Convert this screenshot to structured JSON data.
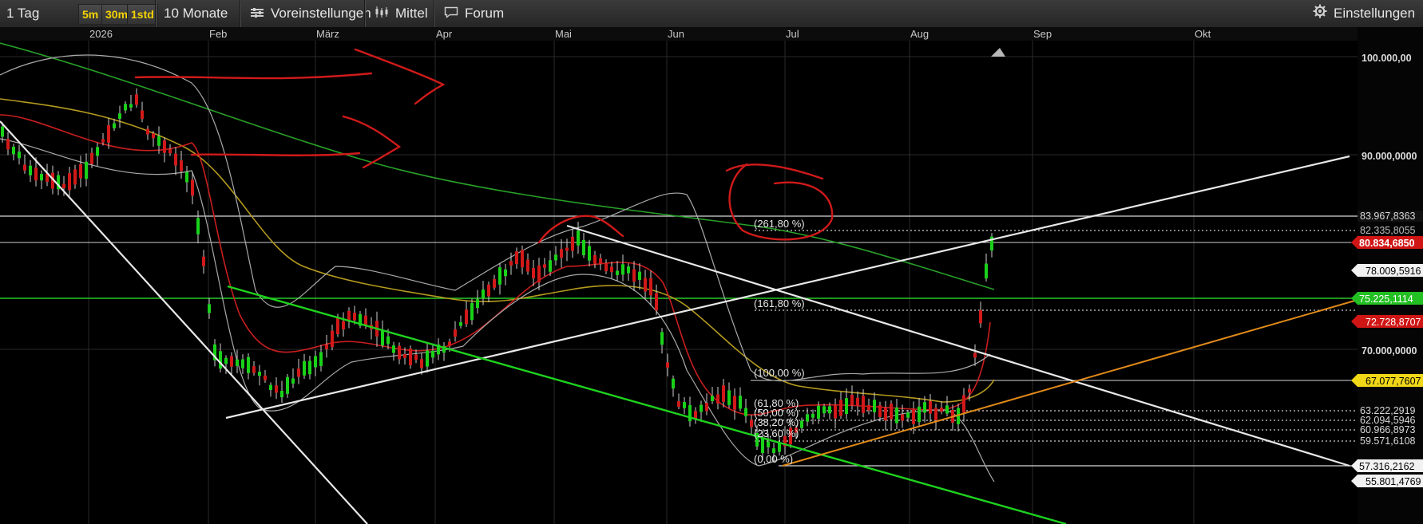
{
  "toolbar": {
    "period": "1 Tag",
    "intervals": [
      "5m",
      "30m",
      "1std"
    ],
    "range": "10 Monate",
    "presets": "Voreinstellungen",
    "candles": "Mittel",
    "forum": "Forum",
    "settings": "Einstellungen"
  },
  "months": [
    "2026",
    "Feb",
    "März",
    "Apr",
    "Mai",
    "Jun",
    "Jul",
    "Aug",
    "Sep",
    "Okt"
  ],
  "axis": {
    "grid_labels": [
      "100.000,00",
      "90.000,0000",
      "70.000,0000"
    ],
    "price_tags": {
      "hline_top": "83.967,8363",
      "dotted_top": "82.335,8055",
      "current": "80.834,6850",
      "white_1": "78.009,5916",
      "green_1": "75.225,1114",
      "red_1": "72.728,8707",
      "yellow_1": "67.077,7607",
      "fib_1": "63.222,2919",
      "fib_2": "62.094,5946",
      "fib_3": "60.966,8973",
      "fib_4": "59.571,6108",
      "fib_base": "57.316,2162",
      "low": "55.801,4769"
    }
  },
  "fib_labels": [
    "(261,80 %)",
    "(161,80 %)",
    "(100,00 %)",
    "(61,80 %)",
    "(50,00 %)",
    "(38,20 %)",
    "(23,60 %)",
    "(0,00 %)"
  ],
  "colors": {
    "up": "#19d219",
    "down": "#d21919",
    "ma_red": "#c81e1e",
    "ma_yellow": "#b49a1e",
    "ma_green": "#28a028",
    "annotation": "#d01a1a",
    "trend_orange": "#e08a1a",
    "current_tag": "#d01515",
    "green_tag": "#22c022",
    "yellow_tag": "#f0d818"
  }
}
